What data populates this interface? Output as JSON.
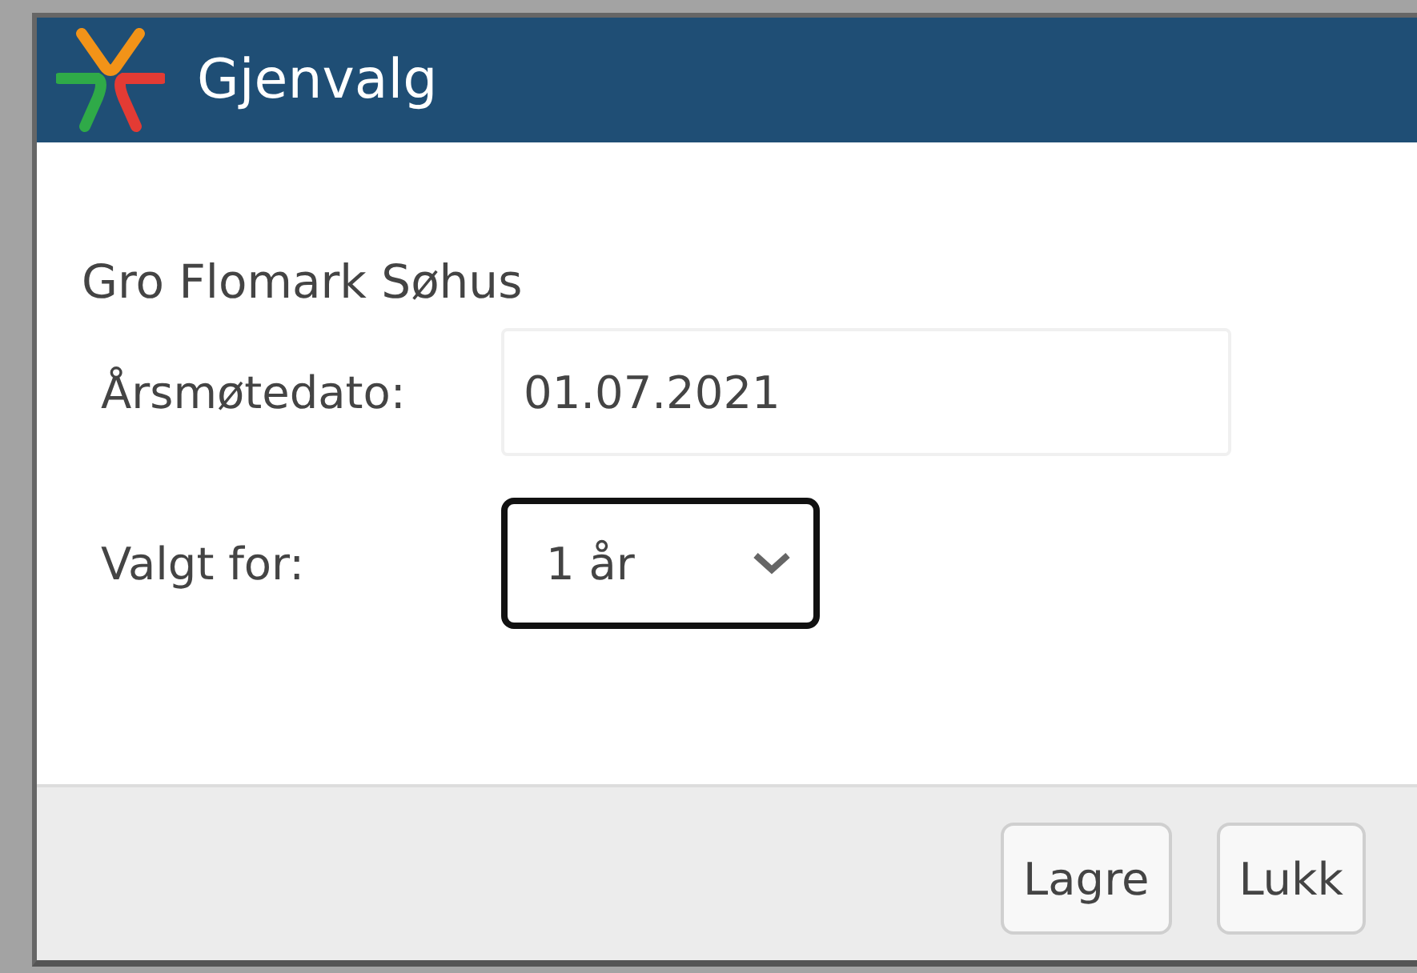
{
  "window": {
    "title": "Gjenvalg"
  },
  "person": {
    "name": "Gro Flomark Søhus"
  },
  "fields": [
    {
      "kind": "text",
      "label": "Årsmøtedato:",
      "value": "01.07.2021",
      "focused": false
    },
    {
      "kind": "select",
      "label": "Valgt for:",
      "value": "1 år",
      "focused": true
    }
  ],
  "buttons": [
    "Lagre",
    "Lukk"
  ]
}
